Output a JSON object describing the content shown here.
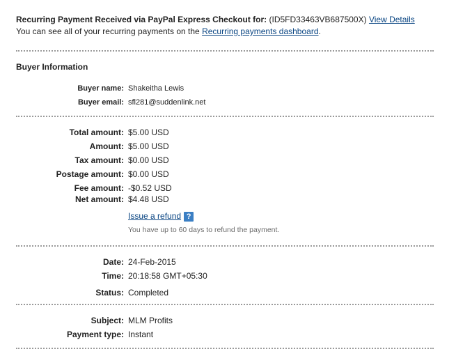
{
  "header": {
    "title": "Recurring Payment Received via PayPal Express Checkout for:",
    "profile_id": "(ID5FD33463VB687500X)",
    "view_details": "View Details",
    "dashboard_prefix": "You can see all of your recurring payments on the",
    "dashboard_link": "Recurring payments dashboard",
    "dashboard_suffix": "."
  },
  "buyer": {
    "section_title": "Buyer Information",
    "name_label": "Buyer name:",
    "name": "Shakeitha Lewis",
    "email_label": "Buyer email:",
    "email": "sfl281@suddenlink.net"
  },
  "amounts": {
    "total_label": "Total amount:",
    "total": "$5.00 USD",
    "amount_label": "Amount:",
    "amount": "$5.00 USD",
    "tax_label": "Tax amount:",
    "tax": "$0.00 USD",
    "postage_label": "Postage amount:",
    "postage": "$0.00 USD",
    "fee_label": "Fee amount:",
    "fee": "-$0.52 USD",
    "net_label": "Net amount:",
    "net": "$4.48 USD",
    "refund_link": "Issue a refund",
    "help_icon": "?",
    "refund_note": "You have up to 60 days to refund the payment."
  },
  "transaction": {
    "date_label": "Date:",
    "date": "24-Feb-2015",
    "time_label": "Time:",
    "time": "20:18:58 GMT+05:30",
    "status_label": "Status:",
    "status": "Completed"
  },
  "details": {
    "subject_label": "Subject:",
    "subject": "MLM Profits",
    "payment_type_label": "Payment type:",
    "payment_type": "Instant"
  },
  "colors": {
    "link": "#084482",
    "divider": "#9a9a9a",
    "help_icon_bg": "#3b7fc4",
    "note_text": "#6b6b6b"
  },
  "icons": {
    "help": "help-icon"
  }
}
